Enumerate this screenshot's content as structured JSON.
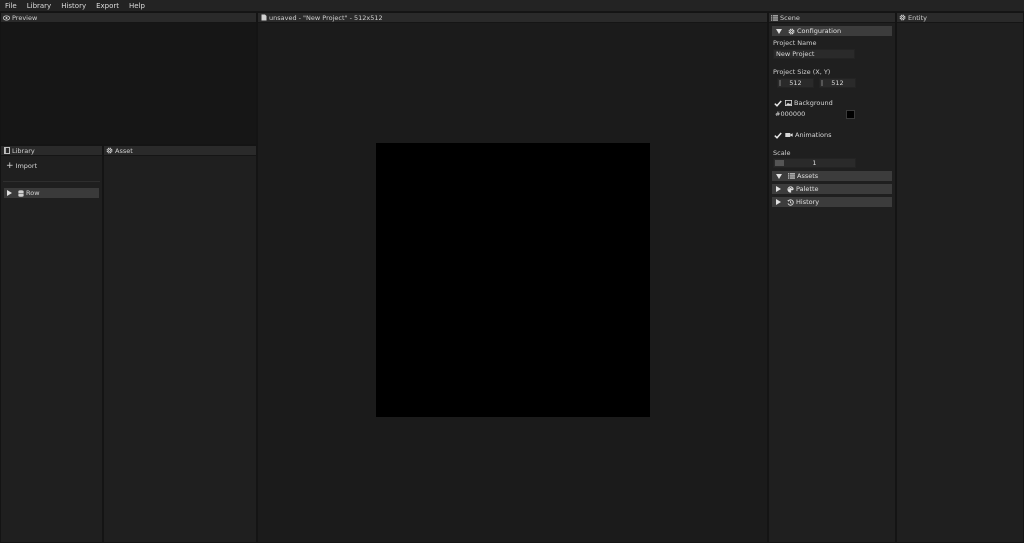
{
  "menubar": {
    "items": [
      "File",
      "Library",
      "History",
      "Export",
      "Help"
    ]
  },
  "preview": {
    "title": "Preview",
    "icon": "eye-icon"
  },
  "library": {
    "title": "Library",
    "icon": "book-icon",
    "import_label": "Import",
    "rows": [
      {
        "label": "Row",
        "icon": "database-icon",
        "expanded": false
      }
    ]
  },
  "asset": {
    "title": "Asset",
    "icon": "gear-icon"
  },
  "viewport": {
    "title": "unsaved - \"New Project\" - 512x512",
    "icon": "file-icon",
    "canvas_color": "#000000"
  },
  "scene": {
    "title": "Scene",
    "icon": "list-icon",
    "configuration": {
      "label": "Configuration",
      "project_name_label": "Project Name",
      "project_name_value": "New Project",
      "project_size_label": "Project Size (X, Y)",
      "size_x": "512",
      "size_y": "512",
      "background_label": "Background",
      "background_checked": true,
      "background_value": "#000000",
      "animations_label": "Animations",
      "animations_checked": true,
      "scale_label": "Scale",
      "scale_value": "1"
    },
    "sections": {
      "assets": "Assets",
      "palette": "Palette",
      "history": "History"
    }
  },
  "entity": {
    "title": "Entity",
    "icon": "gear-icon"
  },
  "colors": {
    "background": "#1c1c1c",
    "panel_header": "#2a2a2a",
    "section_header": "#3c3c3c",
    "canvas": "#000000"
  }
}
